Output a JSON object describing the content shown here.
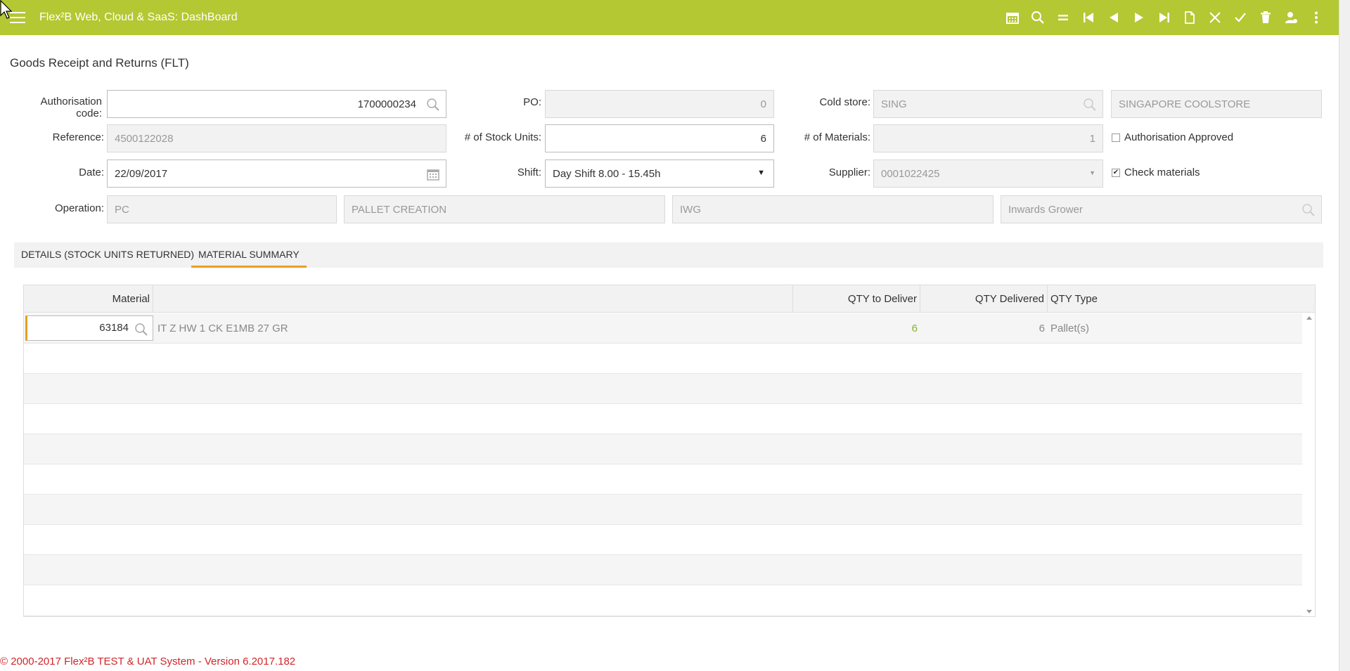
{
  "app": {
    "title": "Flex²B Web, Cloud & SaaS: DashBoard",
    "accent_color": "#b3c832"
  },
  "toolbar": {
    "icons": [
      "calendar-icon",
      "search-icon",
      "equals-icon",
      "first-record-icon",
      "previous-record-icon",
      "next-record-icon",
      "last-record-icon",
      "new-document-icon",
      "close-icon",
      "check-icon",
      "delete-icon",
      "user-icon",
      "more-vertical-icon"
    ]
  },
  "page": {
    "title": "Goods Receipt and Returns (FLT)"
  },
  "form": {
    "auth_code_label": "Authorisation code:",
    "auth_code_value": "1700000234",
    "po_label": "PO:",
    "po_value": "0",
    "cold_store_label": "Cold store:",
    "cold_store_code": "SING",
    "cold_store_name": "SINGAPORE COOLSTORE",
    "reference_label": "Reference:",
    "reference_value": "4500122028",
    "stock_units_label": "# of Stock Units:",
    "stock_units_value": "6",
    "materials_label": "# of Materials:",
    "materials_value": "1",
    "auth_approved_label": "Authorisation Approved",
    "auth_approved_checked": false,
    "date_label": "Date:",
    "date_value": "22/09/2017",
    "shift_label": "Shift:",
    "shift_value": "Day Shift 8.00 - 15.45h",
    "supplier_label": "Supplier:",
    "supplier_value": "0001022425",
    "check_materials_label": "Check materials",
    "check_materials_checked": true,
    "operation_label": "Operation:",
    "operation_code": "PC",
    "operation_name": "PALLET CREATION",
    "operation_type_code": "IWG",
    "operation_type_name": "Inwards Grower"
  },
  "tabs": [
    {
      "label": "DETAILS (STOCK UNITS RETURNED)",
      "active": false
    },
    {
      "label": "MATERIAL SUMMARY",
      "active": true
    }
  ],
  "grid": {
    "columns": [
      "Material",
      "QTY to Deliver",
      "QTY Delivered",
      "QTY Type"
    ],
    "rows": [
      {
        "material": "63184",
        "description": "IT Z HW 1 CK E1MB 27 GR",
        "qty_to_deliver": "6",
        "qty_delivered": "6",
        "qty_type": "Pallet(s)"
      }
    ]
  },
  "footer": {
    "text": "© 2000-2017 Flex²B TEST & UAT System - Version 6.2017.182"
  }
}
